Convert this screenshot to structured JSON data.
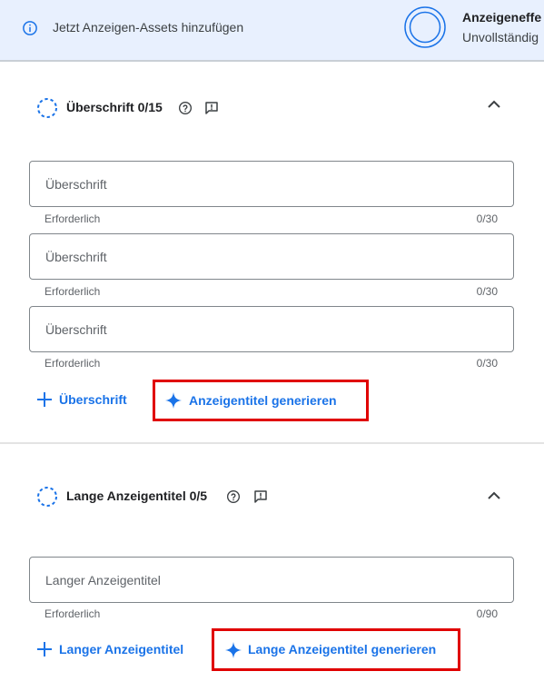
{
  "banner": {
    "info_text": "Jetzt Anzeigen-Assets hinzufügen",
    "effectiveness_title": "Anzeigeneffe",
    "effectiveness_status": "Unvollständig"
  },
  "headlines": {
    "title": "Überschrift 0/15",
    "fields": [
      {
        "placeholder": "Überschrift",
        "value": "",
        "hint": "Erforderlich",
        "counter": "0/30"
      },
      {
        "placeholder": "Überschrift",
        "value": "",
        "hint": "Erforderlich",
        "counter": "0/30"
      },
      {
        "placeholder": "Überschrift",
        "value": "",
        "hint": "Erforderlich",
        "counter": "0/30"
      }
    ],
    "add_label": "Überschrift",
    "generate_label": "Anzeigentitel generieren"
  },
  "long_headlines": {
    "title": "Lange Anzeigentitel 0/5",
    "fields": [
      {
        "placeholder": "Langer Anzeigentitel",
        "value": "",
        "hint": "Erforderlich",
        "counter": "0/90"
      }
    ],
    "add_label": "Langer Anzeigentitel",
    "generate_label": "Lange Anzeigentitel generieren"
  },
  "colors": {
    "accent": "#1a73e8",
    "banner_bg": "#e8f0fe",
    "highlight": "#e00000"
  },
  "icons": {
    "info": "info-icon",
    "ring": "effectiveness-ring-icon",
    "section": "dashed-circle-icon",
    "help": "help-icon",
    "feedback": "feedback-icon",
    "collapse": "chevron-up-icon",
    "add": "plus-icon",
    "generate": "sparkle-icon"
  }
}
